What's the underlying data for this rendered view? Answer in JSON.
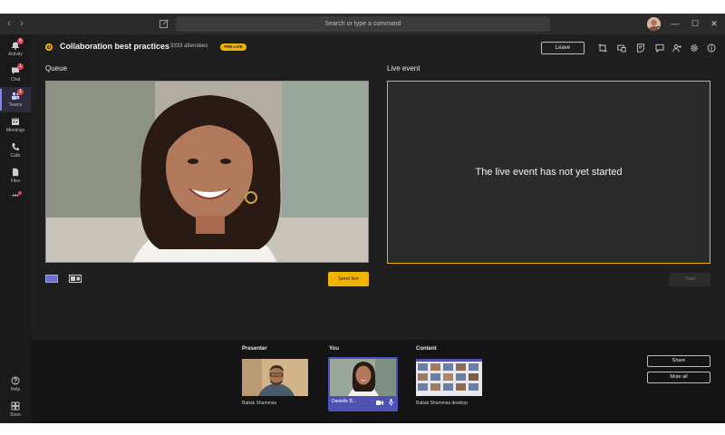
{
  "titlebar": {
    "search_placeholder": "Search or type a command",
    "icons": [
      "back-arrow-icon",
      "forward-arrow-icon",
      "compose-icon",
      "user-avatar",
      "minimize-icon",
      "maximize-icon",
      "close-icon"
    ]
  },
  "rail": {
    "items": [
      {
        "label": "Activity",
        "icon": "bell-icon",
        "badge": "6"
      },
      {
        "label": "Chat",
        "icon": "chat-icon",
        "badge": "1"
      },
      {
        "label": "Teams",
        "icon": "teams-icon",
        "badge": "1",
        "active": true
      },
      {
        "label": "Meetings",
        "icon": "calendar-icon"
      },
      {
        "label": "Calls",
        "icon": "phone-icon"
      },
      {
        "label": "Files",
        "icon": "file-icon"
      }
    ],
    "more_glyph": "•••",
    "bottom": [
      {
        "label": "Help",
        "icon": "help-icon"
      },
      {
        "label": "Store",
        "icon": "store-icon"
      }
    ]
  },
  "meeting": {
    "title": "Collaboration best practices",
    "attendees": "3333 attendees",
    "status_badge": "PRE-LIVE",
    "leave_label": "Leave",
    "toolbar_icons": [
      "crop-icon",
      "device-settings-icon",
      "notes-icon",
      "chat-icon",
      "participants-icon",
      "settings-icon",
      "info-icon"
    ]
  },
  "queue": {
    "heading": "Queue",
    "send_live_label": "Send live",
    "layout_icons": [
      "single-layout-icon",
      "side-by-side-layout-icon"
    ]
  },
  "live_event": {
    "heading": "Live event",
    "message": "The live event has not yet started",
    "start_label": "Start"
  },
  "tray": {
    "presenter": {
      "heading": "Presenter",
      "name": "Babak Shammas"
    },
    "you": {
      "heading": "You",
      "name": "Danielle B..."
    },
    "content": {
      "heading": "Content",
      "name": "Babak Shammas desktop"
    },
    "share_label": "Share",
    "mute_all_label": "Mute all"
  },
  "colors": {
    "accent": "#f0b400",
    "brand": "#4f52b2",
    "background": "#1f1f1f"
  }
}
